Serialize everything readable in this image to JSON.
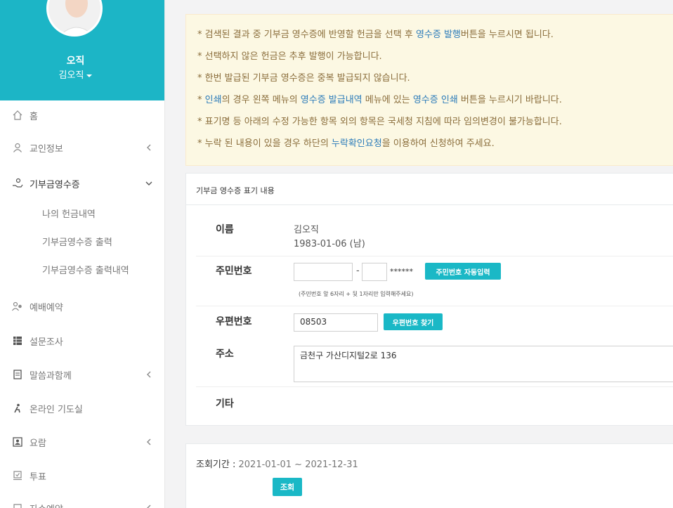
{
  "profile": {
    "name": "오직",
    "sub": "김오직"
  },
  "nav": [
    {
      "label": "홈"
    },
    {
      "label": "교인정보"
    },
    {
      "label": "기부금영수증"
    },
    {
      "label": "예배예약"
    },
    {
      "label": "설문조사"
    },
    {
      "label": "말씀과함께"
    },
    {
      "label": "온라인 기도실"
    },
    {
      "label": "요람"
    },
    {
      "label": "투표"
    },
    {
      "label": "자수예약"
    }
  ],
  "subnav": [
    "나의 헌금내역",
    "기부금영수증 출력",
    "기부금영수증 출력내역"
  ],
  "notice": [
    {
      "pre": "* 검색된 결과 중 기부금 영수증에 반영할 헌금을 선택 후 ",
      "hl": "영수증 발행",
      "post": "버튼을 누르시면 됩니다."
    },
    {
      "pre": "* 선택하지 않은 헌금은 추후 발행이 가능합니다.",
      "hl": "",
      "post": ""
    },
    {
      "pre": "* 한번 발급된 기부금 영수증은 중복 발급되지 않습니다.",
      "hl": "",
      "post": ""
    },
    {
      "pre": "* ",
      "hl": "인쇄",
      "post": "의 경우 왼쪽 메뉴의 ",
      "hl2": "영수증 발급내역",
      "post2": " 메뉴에 있는 ",
      "hl3": "영수증 인쇄",
      "post3": " 버튼을 누르시기 바랍니다."
    },
    {
      "pre": "* 표기명 등 아래의 수정 가능한 항목 외의 항목은 국세청 지침에 따라 임의변경이 불가능합니다.",
      "hl": "",
      "post": ""
    },
    {
      "pre": "* 누락 된 내용이 있을 경우 하단의 ",
      "hl": "누락확인요청",
      "post": "을 이용하여 신청하여 주세요."
    }
  ],
  "receipt": {
    "title": "기부금 영수증 표기 내용",
    "name_label": "이름",
    "name_value": "김오직",
    "birth_value": "1983-01-06 (남)",
    "ssn_label": "주민번호",
    "ssn_dash": "-",
    "ssn_mask": "******",
    "ssn_button": "주민번호 자동입력",
    "ssn_hint": "(주민번호 앞 6자리 + 뒷 1자리만 입력해주세요)",
    "zip_label": "우편번호",
    "zip_value": "08503",
    "zip_button": "우편번호 찾기",
    "addr_label": "주소",
    "addr_value": "금천구 가산디지털2로 136",
    "etc_label": "기타"
  },
  "period": {
    "label": "조회기간 : ",
    "value": "2021-01-01 ~ 2021-12-31",
    "button": "조회"
  },
  "colors": {
    "accent": "#1cb5c6",
    "notice_text": "#8a6d3b",
    "link": "#2b7bb9"
  }
}
